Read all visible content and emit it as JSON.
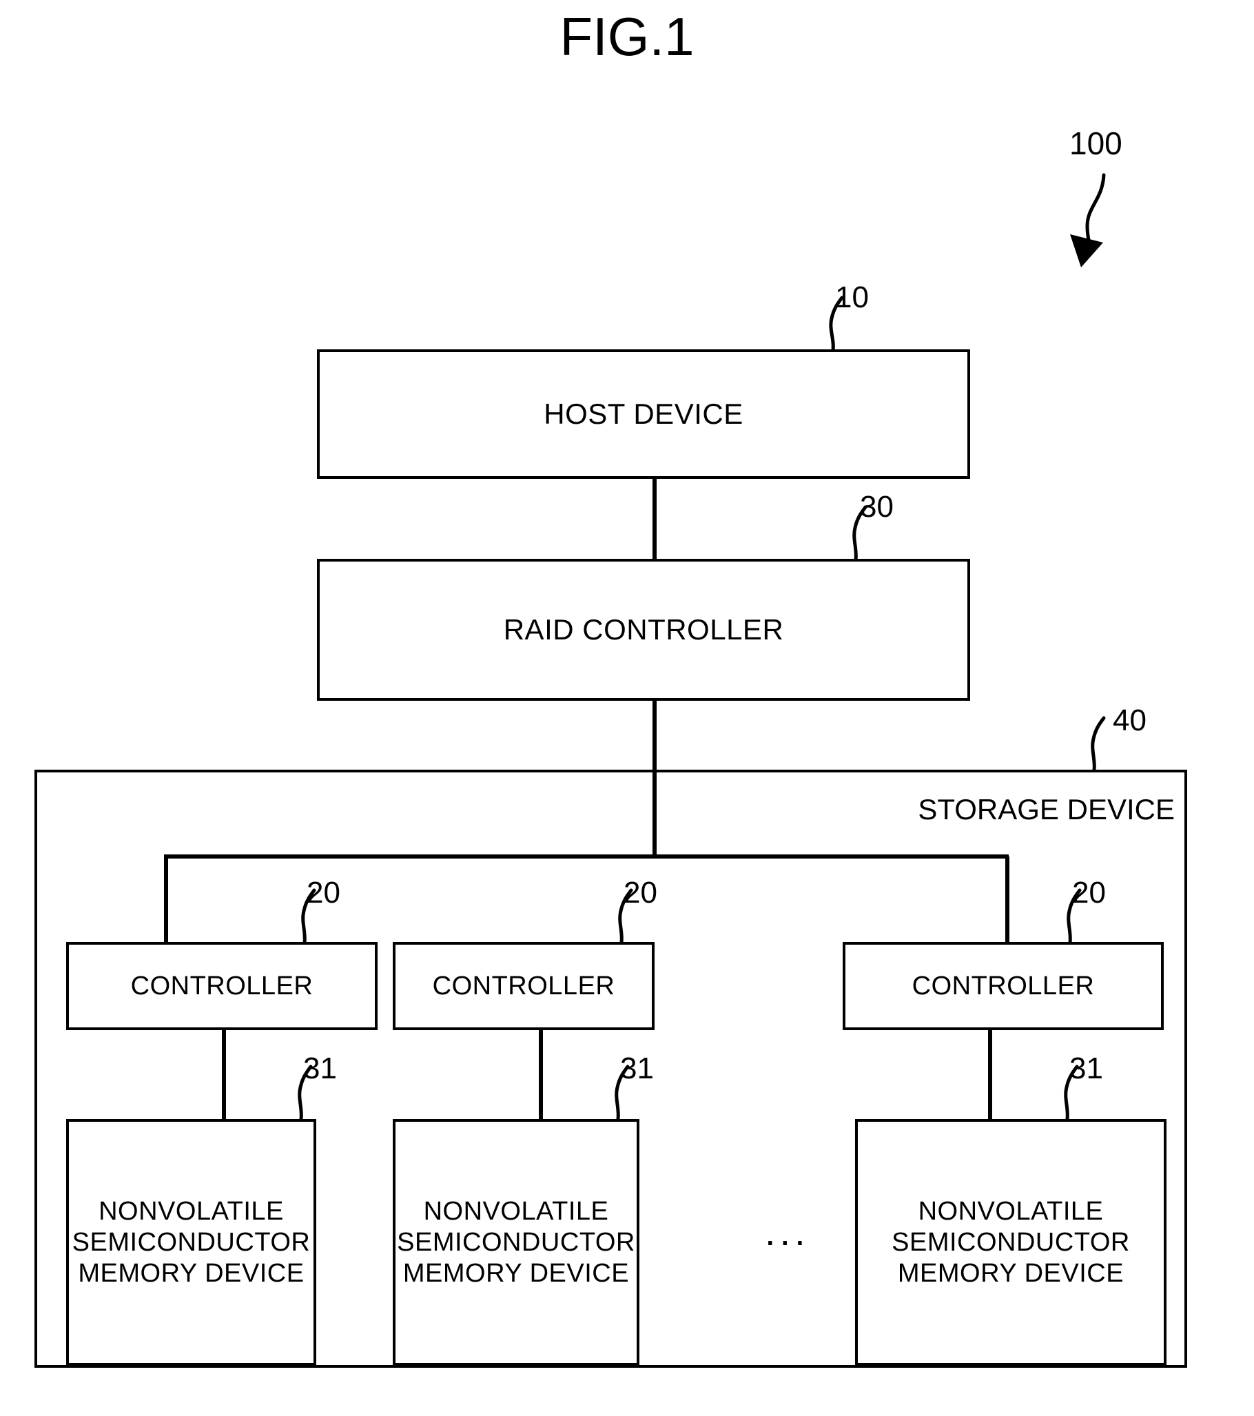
{
  "figure": {
    "title": "FIG.1",
    "system_reference": "100"
  },
  "blocks": {
    "host_device": {
      "label": "HOST DEVICE",
      "ref": "10"
    },
    "raid_controller": {
      "label": "RAID CONTROLLER",
      "ref": "30"
    },
    "storage_device": {
      "label": "STORAGE DEVICE",
      "ref": "40"
    },
    "controllers": [
      {
        "label": "CONTROLLER",
        "ref": "20"
      },
      {
        "label": "CONTROLLER",
        "ref": "20"
      },
      {
        "label": "CONTROLLER",
        "ref": "20"
      }
    ],
    "memories": [
      {
        "label": "NONVOLATILE\nSEMICONDUCTOR\nMEMORY DEVICE",
        "ref": "31"
      },
      {
        "label": "NONVOLATILE\nSEMICONDUCTOR\nMEMORY DEVICE",
        "ref": "31"
      },
      {
        "label": "NONVOLATILE\nSEMICONDUCTOR\nMEMORY DEVICE",
        "ref": "31"
      }
    ],
    "ellipsis": "..."
  },
  "chart_data": {
    "type": "diagram",
    "title": "FIG.1",
    "nodes": [
      {
        "id": "100",
        "label": "",
        "kind": "system-arrow"
      },
      {
        "id": "10",
        "label": "HOST DEVICE",
        "kind": "box"
      },
      {
        "id": "30",
        "label": "RAID CONTROLLER",
        "kind": "box"
      },
      {
        "id": "40",
        "label": "STORAGE DEVICE",
        "kind": "container"
      },
      {
        "id": "20a",
        "label": "CONTROLLER",
        "kind": "box"
      },
      {
        "id": "20b",
        "label": "CONTROLLER",
        "kind": "box"
      },
      {
        "id": "20c",
        "label": "CONTROLLER",
        "kind": "box"
      },
      {
        "id": "31a",
        "label": "NONVOLATILE SEMICONDUCTOR MEMORY DEVICE",
        "kind": "box"
      },
      {
        "id": "31b",
        "label": "NONVOLATILE SEMICONDUCTOR MEMORY DEVICE",
        "kind": "box"
      },
      {
        "id": "31c",
        "label": "NONVOLATILE SEMICONDUCTOR MEMORY DEVICE",
        "kind": "box"
      }
    ],
    "edges": [
      {
        "from": "10",
        "to": "30"
      },
      {
        "from": "30",
        "to": "40"
      },
      {
        "from": "40",
        "to": "20a"
      },
      {
        "from": "40",
        "to": "20b"
      },
      {
        "from": "40",
        "to": "20c"
      },
      {
        "from": "20a",
        "to": "31a"
      },
      {
        "from": "20b",
        "to": "31b"
      },
      {
        "from": "20c",
        "to": "31c"
      }
    ]
  }
}
